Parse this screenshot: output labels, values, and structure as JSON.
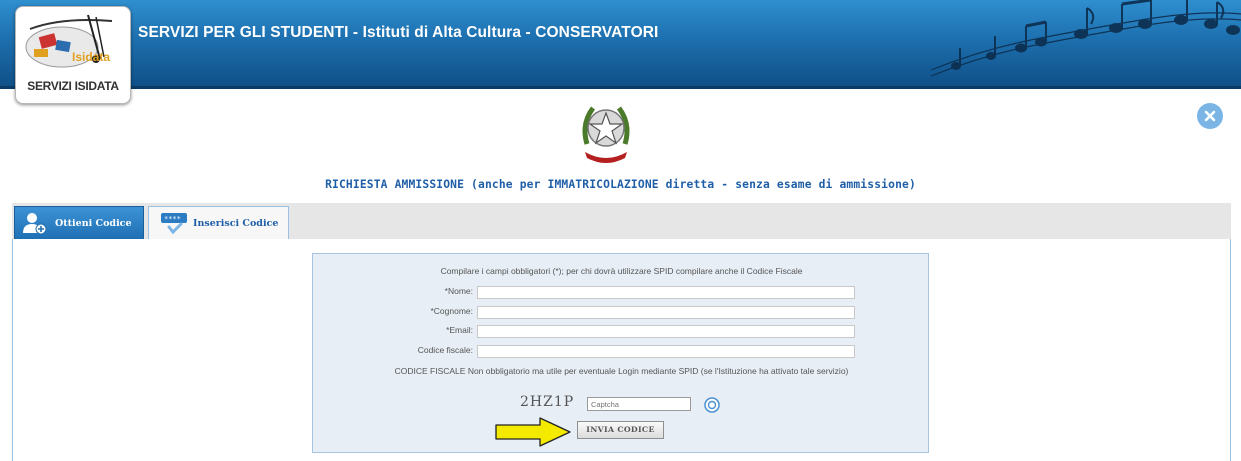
{
  "header": {
    "title": "SERVIZI PER GLI STUDENTI - Istituti di Alta Cultura - CONSERVATORI",
    "logo_caption": "SERVIZI ISIDATA",
    "logo_wordmark": "Isidata"
  },
  "main": {
    "title": "RICHIESTA AMMISSIONE (anche per IMMATRICOLAZIONE diretta - senza esame di ammissione)"
  },
  "tabs": [
    {
      "label": "Ottieni Codice",
      "icon": "user-icon",
      "active": true
    },
    {
      "label": "Inserisci Codice",
      "icon": "keyboard-check-icon",
      "active": false
    }
  ],
  "form": {
    "intro": "Compilare i campi obbligatori (*); per chi dovrà utilizzare SPID compilare anche il Codice Fiscale",
    "fields": [
      {
        "label": "*Nome:",
        "value": ""
      },
      {
        "label": "*Cognome:",
        "value": ""
      },
      {
        "label": "*Email:",
        "value": ""
      },
      {
        "label": "Codice fiscale:",
        "value": ""
      }
    ],
    "note": "CODICE FISCALE Non obbligatorio ma utile per eventuale Login mediante SPID (se l'Istituzione ha attivato tale servizio)",
    "captcha_code": "2HZ1P",
    "captcha_placeholder": "Captcha",
    "submit_label": "INVIA CODICE"
  },
  "colors": {
    "header_blue": "#1d6fae",
    "title_blue": "#1f5fa8",
    "arrow_yellow": "#f4ea00"
  }
}
